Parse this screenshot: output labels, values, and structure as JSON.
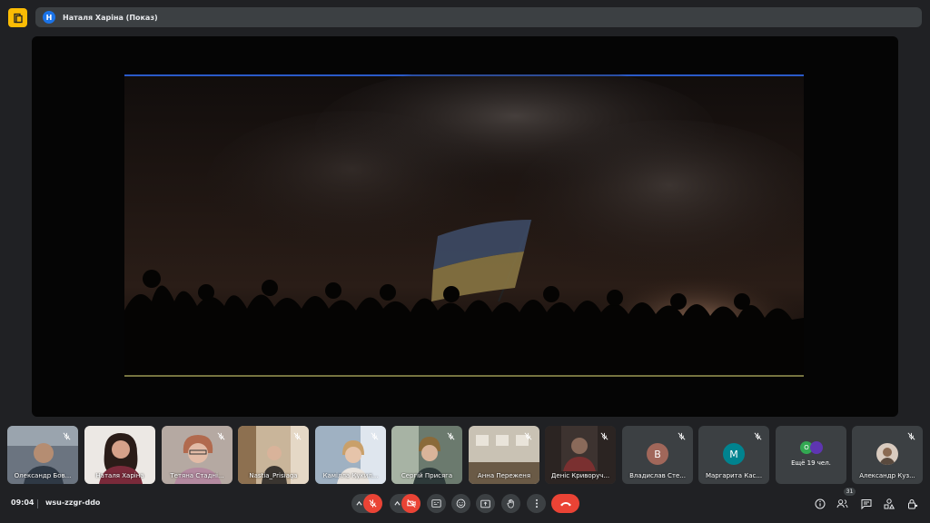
{
  "app": {
    "icon": "meet-doc-icon"
  },
  "presenter": {
    "avatar_letter": "Н",
    "label": "Наталя Харіна (Показ)"
  },
  "stage": {
    "content": "shared-video-flag-crowd-smoke"
  },
  "participants": [
    {
      "name": "Олександр Бов...",
      "type": "video",
      "muted": true
    },
    {
      "name": "Наталя Харіна",
      "type": "video",
      "muted": false
    },
    {
      "name": "Тетяна Стадні...",
      "type": "video",
      "muted": true
    },
    {
      "name": "Nastia_Prisiaga",
      "type": "video",
      "muted": true
    },
    {
      "name": "Камілла Кукил...",
      "type": "video",
      "muted": true
    },
    {
      "name": "Сергій Присяга",
      "type": "video",
      "muted": true
    },
    {
      "name": "Анна Переженя",
      "type": "video",
      "muted": true
    },
    {
      "name": "Деніс Криворуч...",
      "type": "video",
      "muted": true
    },
    {
      "name": "Владислав Сте...",
      "type": "letter",
      "letter": "В",
      "color": "#a1675a",
      "muted": true
    },
    {
      "name": "Маргарита Кас...",
      "type": "letter",
      "letter": "М",
      "color": "#00838f",
      "muted": true
    },
    {
      "name": "Ещё 19 чел.",
      "type": "more",
      "letters": [
        "О",
        ""
      ],
      "colors": [
        "#33a852",
        "#5e35b1"
      ]
    },
    {
      "name": "Александр Куз...",
      "type": "photo",
      "muted": true
    }
  ],
  "bottom_bar": {
    "time": "09:04",
    "meeting_code": "wsu-zzgr-ddo",
    "controls": {
      "mic": {
        "state": "off"
      },
      "camera": {
        "state": "off"
      },
      "captions": "cc-icon",
      "reactions": "emoji-icon",
      "present": "present-screen-icon",
      "raise_hand": "hand-icon",
      "more": "more-vert-icon",
      "leave": "end-call-icon"
    },
    "right": {
      "people_count": "31"
    }
  },
  "colors": {
    "background": "#202124",
    "surface": "#3c4043",
    "danger": "#ea4335",
    "accent": "#fbbc04"
  }
}
